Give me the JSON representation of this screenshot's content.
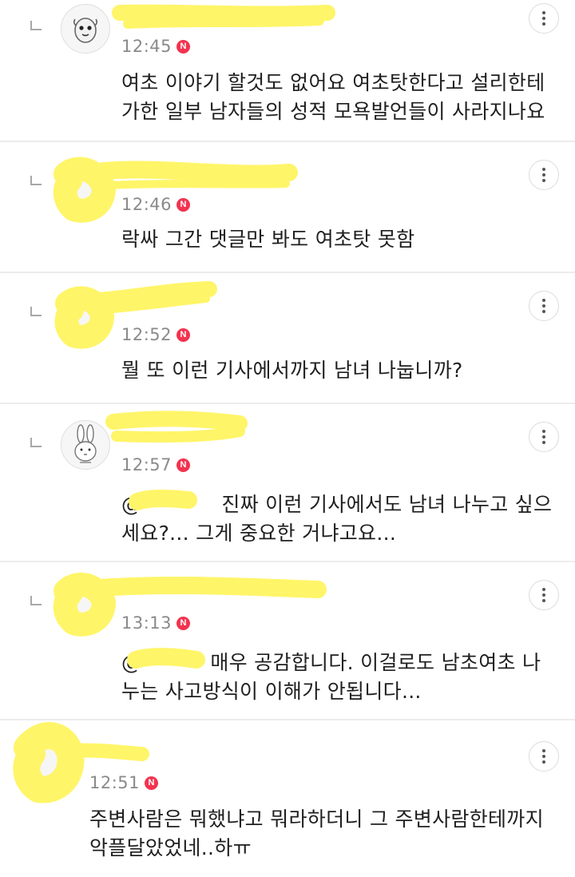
{
  "comments": [
    {
      "username": "",
      "time": "12:45",
      "badge": "N",
      "lines": [
        "여초 이야기 할것도 없어요 여초탓한다고 설리한테",
        "가한 일부 남자들의 성적 모욕발언들이 사라지나요"
      ]
    },
    {
      "username": "",
      "time": "12:46",
      "badge": "N",
      "lines": [
        "락싸 그간 댓글만 봐도 여초탓 못함"
      ]
    },
    {
      "username": "",
      "time": "12:52",
      "badge": "N",
      "lines": [
        "뭘 또 이런 기사에서까지 남녀 나눕니까?"
      ]
    },
    {
      "username": "",
      "time": "12:57",
      "badge": "N",
      "mention": "@",
      "lines": [
        "진짜 이런 기사에서도 남녀 나누고 싶으",
        "세요?... 그게 중요한 거냐고요..."
      ]
    },
    {
      "username": "",
      "time": "13:13",
      "badge": "N",
      "mention": "@",
      "lines": [
        "매우 공감합니다. 이걸로도 남초여초 나",
        "누는 사고방식이 이해가 안됩니다..."
      ]
    },
    {
      "username": "",
      "time": "12:51",
      "badge": "N",
      "lines": [
        "주변사람은 뭐했냐고 뭐라하더니 그 주변사람한테까지",
        "악플달았었네..하ㅠ"
      ]
    }
  ],
  "icons": {
    "reply": "reply-arrow-icon",
    "more": "more-vertical-icon",
    "badge": "new-badge-icon"
  },
  "colors": {
    "badge": "#f2334f",
    "timestamp": "#8a8a8a",
    "redaction": "#fff568"
  }
}
